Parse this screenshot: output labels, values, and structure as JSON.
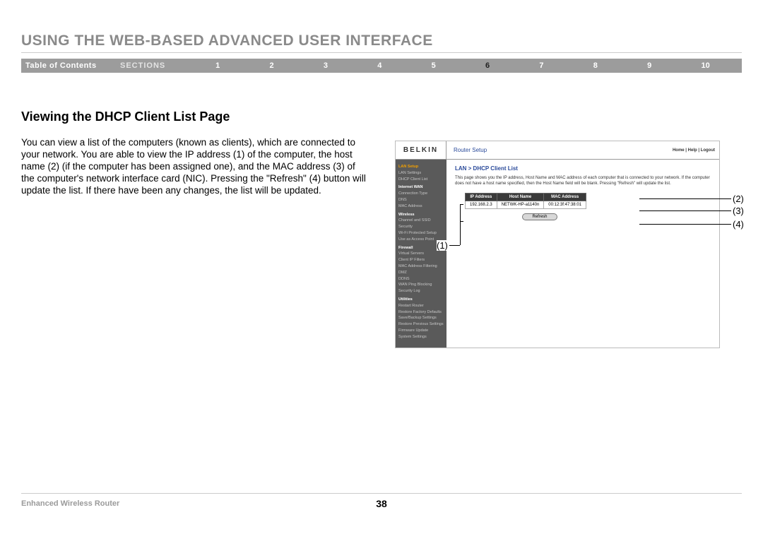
{
  "page_title": "USING THE WEB-BASED ADVANCED USER INTERFACE",
  "nav": {
    "toc": "Table of Contents",
    "sections_label": "SECTIONS",
    "items": [
      "1",
      "2",
      "3",
      "4",
      "5",
      "6",
      "7",
      "8",
      "9",
      "10"
    ],
    "active_index": 5
  },
  "heading": "Viewing the DHCP Client List Page",
  "body": "You can view a list of the computers (known as clients), which are connected to your network. You are able to view the IP address (1) of the computer, the host name (2) (if the computer has been assigned one), and the MAC address (3) of the computer's network interface card (NIC). Pressing the \"Refresh\" (4) button will update the list. If there have been any changes, the list will be updated.",
  "router": {
    "logo": "BELKIN",
    "title": "Router Setup",
    "userlinks": "Home | Help | Logout",
    "breadcrumb": "LAN > DHCP Client List",
    "desc": "This page shows you the IP address, Host Name and MAC address of each computer that is connected to your network. If the computer does not have a host name specified, then the Host Name field will be blank. Pressing \"Refresh\" will update the list.",
    "sidebar": {
      "g1": "LAN Setup",
      "g1a": "LAN Settings",
      "g1b": "DHCP Client List",
      "g2": "Internet WAN",
      "g2a": "Connection Type",
      "g2b": "DNS",
      "g2c": "MAC Address",
      "g3": "Wireless",
      "g3a": "Channel and SSID",
      "g3b": "Security",
      "g3c": "Wi-Fi Protected Setup",
      "g3d": "Use as Access Point",
      "g4": "Firewall",
      "g4a": "Virtual Servers",
      "g4b": "Client IP Filters",
      "g4c": "MAC Address Filtering",
      "g4d": "DMZ",
      "g4e": "DDNS",
      "g4f": "WAN Ping Blocking",
      "g4g": "Security Log",
      "g5": "Utilities",
      "g5a": "Restart Router",
      "g5b": "Restore Factory Defaults",
      "g5c": "Save/Backup Settings",
      "g5d": "Restore Previous Settings",
      "g5e": "Firmware Update",
      "g5f": "System Settings"
    },
    "table": {
      "headers": [
        "IP Address",
        "Host Name",
        "MAC Address"
      ],
      "row": [
        "192.168.2.3",
        "NETWK-HP-a1140n",
        "00:12:3f:47:38:01"
      ]
    },
    "refresh": "Refresh"
  },
  "callouts": {
    "c1": "(1)",
    "c2": "(2)",
    "c3": "(3)",
    "c4": "(4)"
  },
  "footer": {
    "left": "Enhanced Wireless Router",
    "page": "38"
  }
}
